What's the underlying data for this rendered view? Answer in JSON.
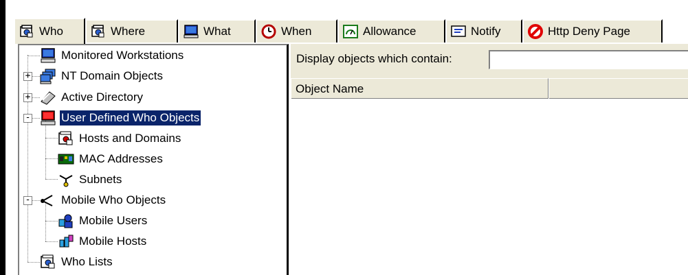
{
  "tabs": [
    {
      "label": "Who",
      "icon": "who-icon",
      "active": true
    },
    {
      "label": "Where",
      "icon": "where-icon",
      "active": false
    },
    {
      "label": "What",
      "icon": "what-icon",
      "active": false
    },
    {
      "label": "When",
      "icon": "clock-icon",
      "active": false
    },
    {
      "label": "Allowance",
      "icon": "allowance-icon",
      "active": false
    },
    {
      "label": "Notify",
      "icon": "notify-icon",
      "active": false
    },
    {
      "label": "Http Deny Page",
      "icon": "deny-icon",
      "active": false
    }
  ],
  "tree": {
    "items": [
      {
        "label": "Monitored Workstations",
        "icon": "workstation-icon"
      },
      {
        "label": "NT Domain Objects",
        "icon": "domain-icon",
        "expander": "+"
      },
      {
        "label": "Active Directory",
        "icon": "active-directory-icon",
        "expander": "+"
      },
      {
        "label": "User Defined Who Objects",
        "icon": "user-defined-icon",
        "expander": "-",
        "selected": true
      },
      {
        "label": "Hosts and Domains",
        "icon": "hosts-icon"
      },
      {
        "label": "MAC Addresses",
        "icon": "mac-icon"
      },
      {
        "label": "Subnets",
        "icon": "subnet-icon"
      },
      {
        "label": "Mobile Who Objects",
        "icon": "mobile-icon",
        "expander": "-"
      },
      {
        "label": "Mobile Users",
        "icon": "mobile-users-icon"
      },
      {
        "label": "Mobile Hosts",
        "icon": "mobile-hosts-icon"
      },
      {
        "label": "Who Lists",
        "icon": "who-lists-icon"
      }
    ]
  },
  "filter": {
    "label": "Display objects which contain:",
    "value": ""
  },
  "list": {
    "columns": [
      "Object Name",
      ""
    ]
  },
  "colors": {
    "selection": "#0a246a",
    "face": "#ece9d8"
  }
}
